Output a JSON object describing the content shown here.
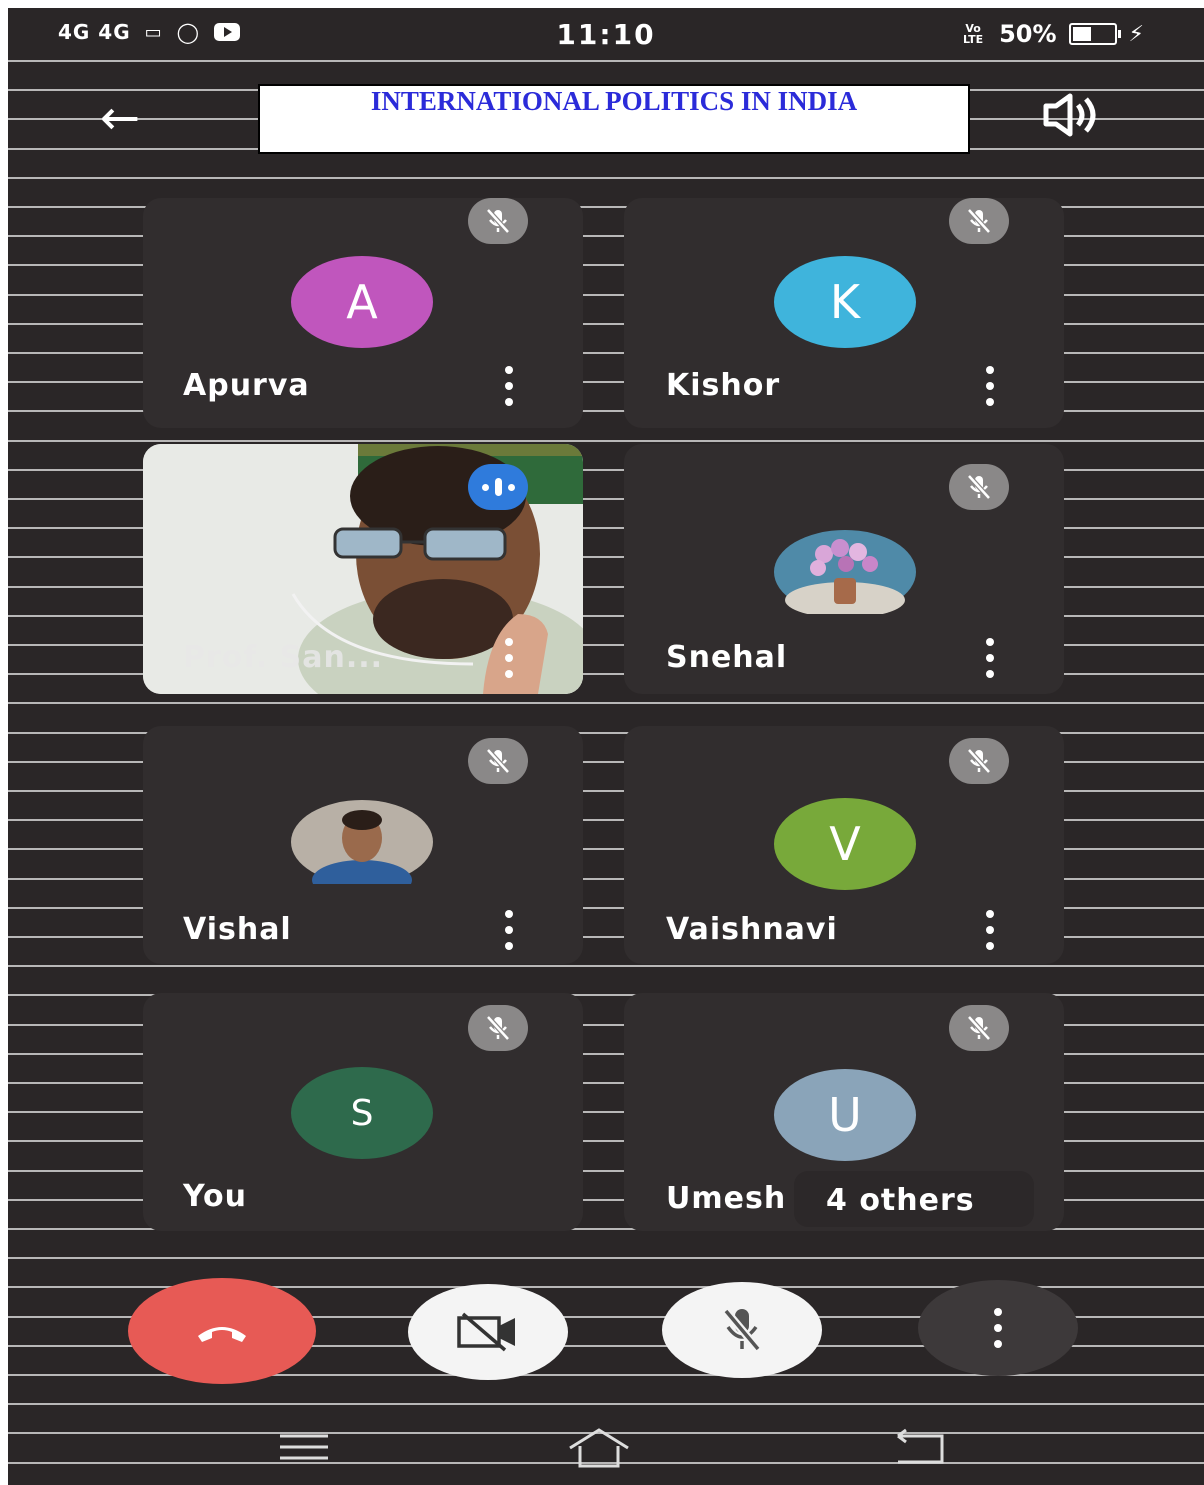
{
  "status_bar": {
    "left_text": "4G 4G",
    "time": "11:10",
    "volte": "Vo LTE",
    "battery": "50%",
    "battery_level": 0.5
  },
  "header": {
    "title": "INTERNATIONAL POLITICS IN INDIA"
  },
  "participants": [
    {
      "name": "Apurva",
      "initial": "A",
      "color": "#c056bd"
    },
    {
      "name": "Kishor",
      "initial": "K",
      "color": "#3fb4dc"
    },
    {
      "name": "Prof. San...",
      "initial": "",
      "color": ""
    },
    {
      "name": "Snehal",
      "initial": "",
      "color": ""
    },
    {
      "name": "Vishal",
      "initial": "",
      "color": ""
    },
    {
      "name": "Vaishnavi",
      "initial": "V",
      "color": "#78a93a"
    },
    {
      "name": "You",
      "initial": "S",
      "color": "#2e6a4c"
    },
    {
      "name": "Umesh",
      "initial": "U",
      "color": "#8aa4b9",
      "others": "4 others"
    }
  ],
  "controls": {
    "end_call_color": "#e75a55",
    "more_color": "#3d393a"
  }
}
